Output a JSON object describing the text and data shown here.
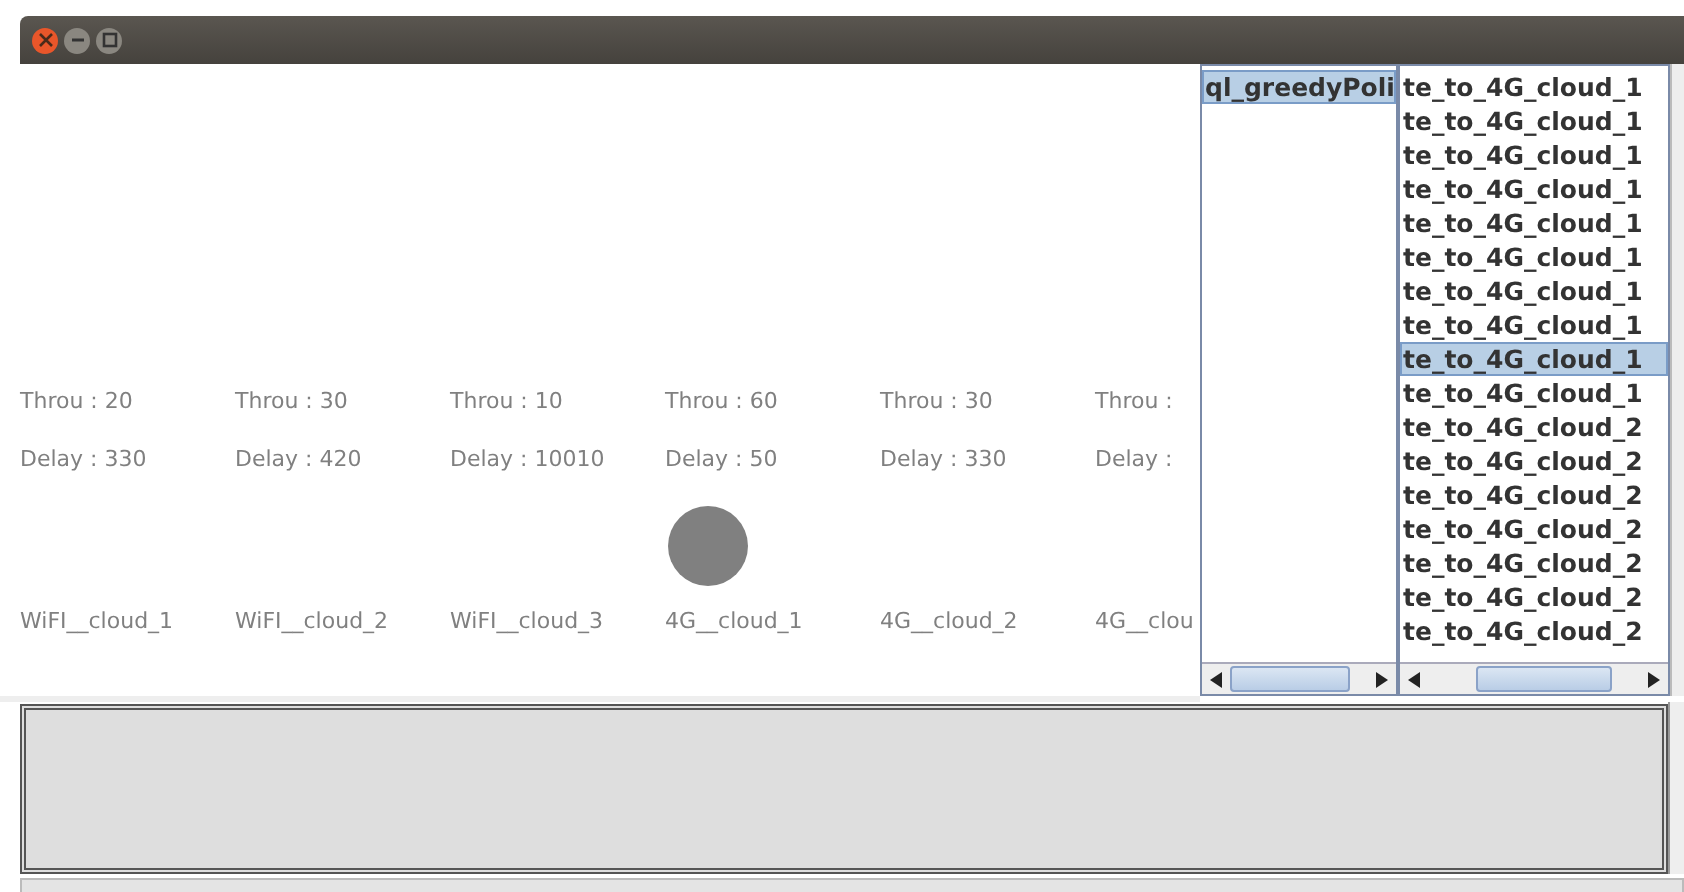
{
  "nodes": [
    {
      "throughput": "Throu :  20",
      "delay": "Delay :  330",
      "name": "WiFI__cloud_1",
      "selected": false
    },
    {
      "throughput": "Throu :  30",
      "delay": "Delay :  420",
      "name": "WiFI__cloud_2",
      "selected": false
    },
    {
      "throughput": "Throu :  10",
      "delay": "Delay :  10010",
      "name": "WiFI__cloud_3",
      "selected": false
    },
    {
      "throughput": "Throu :  60",
      "delay": "Delay :  50",
      "name": "4G__cloud_1",
      "selected": true
    },
    {
      "throughput": "Throu :  30",
      "delay": "Delay :  330",
      "name": "4G__cloud_2",
      "selected": false
    },
    {
      "throughput": "Throu :",
      "delay": "Delay :",
      "name": "4G__clou",
      "selected": false
    }
  ],
  "policy_list": [
    {
      "label": "ql_greedyPoli",
      "selected": true
    }
  ],
  "action_list": [
    {
      "label": "te_to_4G_cloud_1",
      "selected": false
    },
    {
      "label": "te_to_4G_cloud_1",
      "selected": false
    },
    {
      "label": "te_to_4G_cloud_1",
      "selected": false
    },
    {
      "label": "te_to_4G_cloud_1",
      "selected": false
    },
    {
      "label": "te_to_4G_cloud_1",
      "selected": false
    },
    {
      "label": "te_to_4G_cloud_1",
      "selected": false
    },
    {
      "label": "te_to_4G_cloud_1",
      "selected": false
    },
    {
      "label": "te_to_4G_cloud_1",
      "selected": false
    },
    {
      "label": "te_to_4G_cloud_1",
      "selected": true
    },
    {
      "label": "te_to_4G_cloud_1",
      "selected": false
    },
    {
      "label": "te_to_4G_cloud_2",
      "selected": false
    },
    {
      "label": "te_to_4G_cloud_2",
      "selected": false
    },
    {
      "label": "te_to_4G_cloud_2",
      "selected": false
    },
    {
      "label": "te_to_4G_cloud_2",
      "selected": false
    },
    {
      "label": "te_to_4G_cloud_2",
      "selected": false
    },
    {
      "label": "te_to_4G_cloud_2",
      "selected": false
    },
    {
      "label": "te_to_4G_cloud_2",
      "selected": false
    }
  ]
}
